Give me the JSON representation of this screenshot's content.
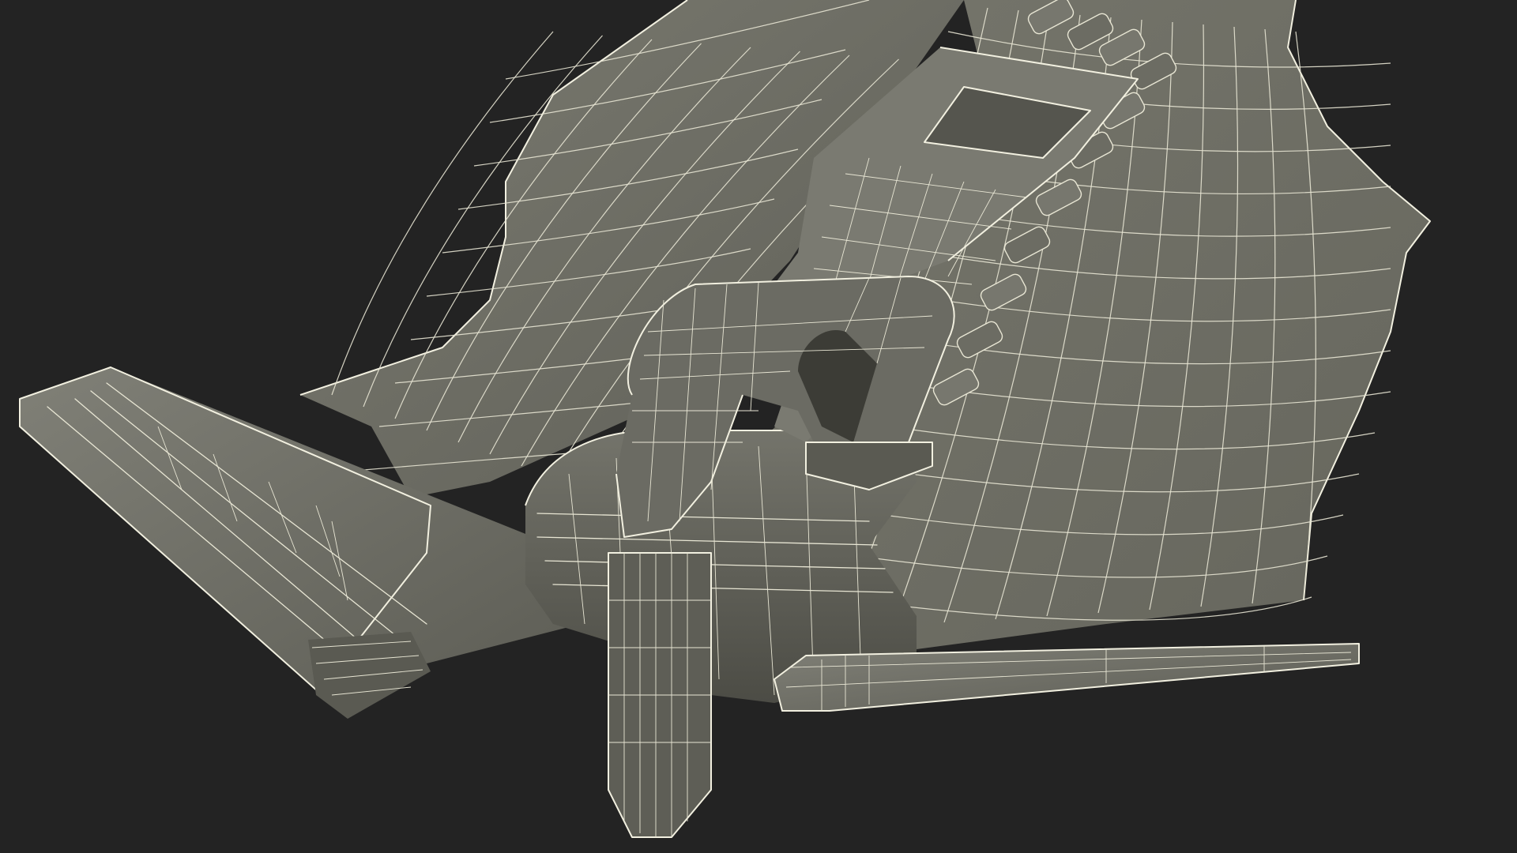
{
  "scene": {
    "subject": "zipper-slider-wireframe-render",
    "colors": {
      "background": "#232323",
      "surface": "#6f6f66",
      "surface_dark": "#4f4f48",
      "surface_light": "#85857b",
      "wire": "#e8e6d4"
    }
  }
}
